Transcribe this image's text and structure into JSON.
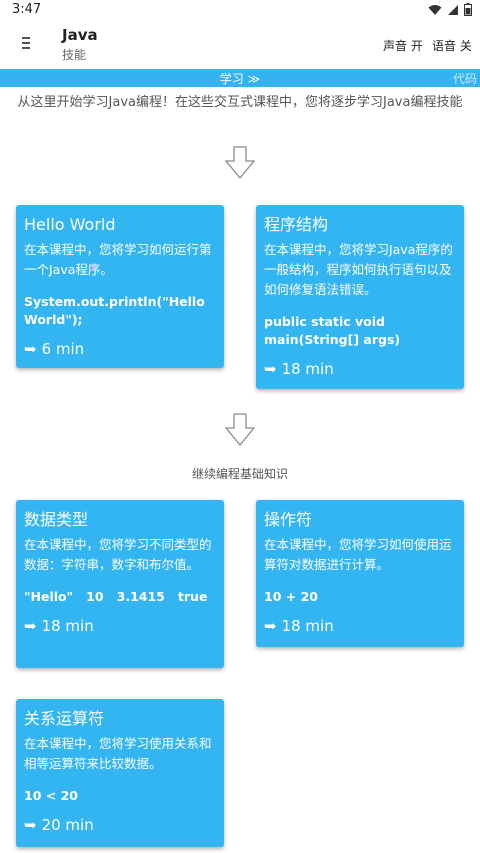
{
  "status": {
    "time": "3:47"
  },
  "app": {
    "title": "Java",
    "subtitle": "技能",
    "sound_label": "声音 开",
    "voice_label": "语音 关"
  },
  "tabs": {
    "learn": "学习 ≫",
    "code": "代码"
  },
  "intro": "从这里开始学习Java编程！在这些交互式课程中，您将逐步学习Java编程技能",
  "section_label": "继续编程基础知识",
  "cards": [
    {
      "title": "Hello World",
      "desc": "在本课程中，您将学习如何运行第一个Java程序。",
      "code": "System.out.println(\"Hello World\");",
      "time": "6 min"
    },
    {
      "title": "程序结构",
      "desc": "在本课程中，您将学习Java程序的一般结构，程序如何执行语句以及如何修复语法错误。",
      "code": "public static void main(String[] args)",
      "time": "18 min"
    },
    {
      "title": "数据类型",
      "desc": "在本课程中，您将学习不同类型的数据：字符串，数字和布尔值。",
      "code": "\"Hello\"   10   3.1415   true",
      "time": "18 min"
    },
    {
      "title": "操作符",
      "desc": "在本课程中，您将学习如何使用运算符对数据进行计算。",
      "code": "10 + 20",
      "time": "18 min"
    },
    {
      "title": "关系运算符",
      "desc": "在本课程中，您将学习使用关系和相等运算符来比较数据。",
      "code": "10 < 20",
      "time": "20 min"
    }
  ],
  "icons": {
    "time": "➥",
    "arrow": "down-arrow-icon"
  },
  "colors": {
    "accent": "#33b5f2"
  }
}
